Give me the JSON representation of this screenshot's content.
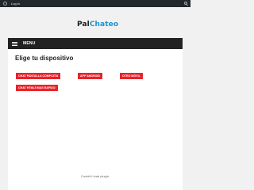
{
  "adminbar": {
    "login_label": "Log in"
  },
  "logo": {
    "part1": "Pal",
    "part2": "Chateo"
  },
  "menu": {
    "label": "MENU"
  },
  "main": {
    "heading": "Elige tu dispositivo",
    "buttons": [
      "CHAT PANTALLA COMPLETA",
      "APP ANDROID",
      "OTRO MÓVIL",
      "CHAT HTML5 MAS RAPIDO"
    ],
    "plugin_message": "Couldn't load plugin."
  },
  "colors": {
    "accent": "#e8242a",
    "brand_blue": "#1a93d1",
    "menubar": "#222222"
  }
}
